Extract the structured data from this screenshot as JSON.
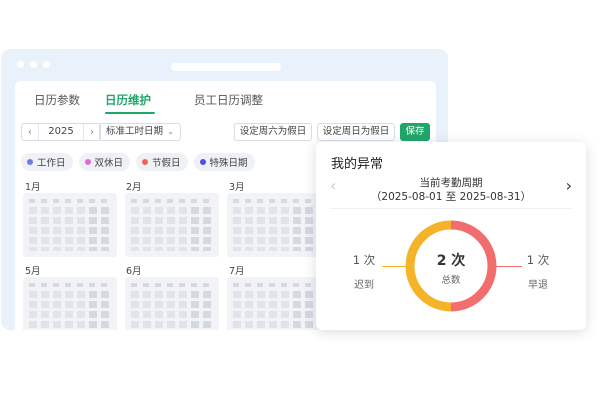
{
  "window": {
    "dots": 3
  },
  "tabs": [
    {
      "label": "日历参数",
      "active": false
    },
    {
      "label": "日历维护",
      "active": true
    },
    {
      "label": "员工日历调整",
      "active": false
    }
  ],
  "toolbar": {
    "year": "2025",
    "calendar_type": "标准工时日期",
    "set_saturday_label": "设定周六为假日",
    "set_sunday_label": "设定周日为假日",
    "save_label": "保存"
  },
  "legend": [
    {
      "label": "工作日",
      "color": "#6b7fe0"
    },
    {
      "label": "双休日",
      "color": "#e06be0"
    },
    {
      "label": "节假日",
      "color": "#f06552"
    },
    {
      "label": "特殊日期",
      "color": "#4f4fe0"
    }
  ],
  "months": [
    "1月",
    "2月",
    "3月",
    "5月",
    "6月",
    "7月"
  ],
  "abnormal_card": {
    "title": "我的异常",
    "period_title": "当前考勤周期",
    "period_range": "（2025-08-01 至 2025-08-31）",
    "total_count": "2 次",
    "total_label": "总数",
    "late": {
      "count": "1 次",
      "label": "迟到",
      "value": 1,
      "color": "#f5b32a"
    },
    "early": {
      "count": "1 次",
      "label": "早退",
      "value": 1,
      "color": "#f26d6d"
    }
  },
  "colors": {
    "accent": "#20a66a"
  }
}
